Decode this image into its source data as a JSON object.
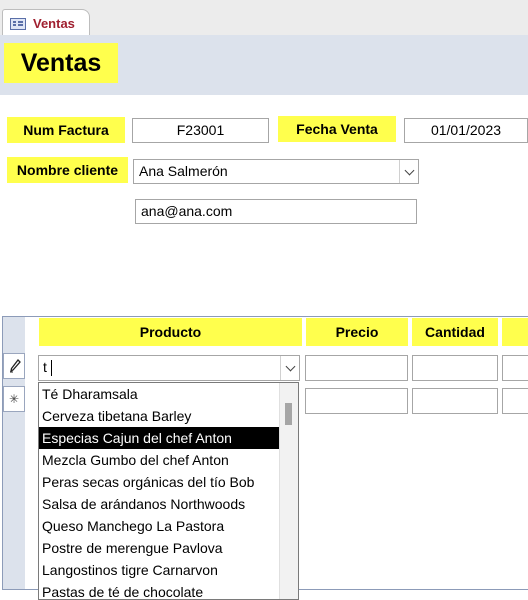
{
  "tab": {
    "label": "Ventas",
    "icon": "form-icon"
  },
  "form": {
    "title": "Ventas"
  },
  "fields": {
    "num_factura": {
      "label": "Num Factura",
      "value": "F23001"
    },
    "fecha_venta": {
      "label": "Fecha Venta",
      "value": "01/01/2023"
    },
    "nombre_cliente": {
      "label": "Nombre cliente",
      "value": "Ana Salmerón"
    },
    "email": {
      "value": "ana@ana.com"
    }
  },
  "subform": {
    "columns": [
      "Producto",
      "Precio",
      "Cantidad"
    ],
    "current_row": {
      "producto_input": "t",
      "selector_icon": "pencil-icon"
    },
    "new_row": {
      "selector_icon": "asterisk-icon",
      "selector_glyph": "✳"
    }
  },
  "dropdown": {
    "items": [
      "Té Dharamsala",
      "Cerveza tibetana Barley",
      "Especias Cajun del chef Anton",
      "Mezcla Gumbo del chef Anton",
      "Peras secas orgánicas del tío Bob",
      "Salsa de arándanos Northwoods",
      "Queso Manchego La Pastora",
      "Postre de merengue Pavlova",
      "Langostinos tigre Carnarvon",
      "Pastas de té de chocolate"
    ],
    "selected_index": 2
  },
  "colors": {
    "label_yellow": "#ffff4d",
    "header_band": "#dce2ec",
    "tab_text": "#a02030"
  }
}
